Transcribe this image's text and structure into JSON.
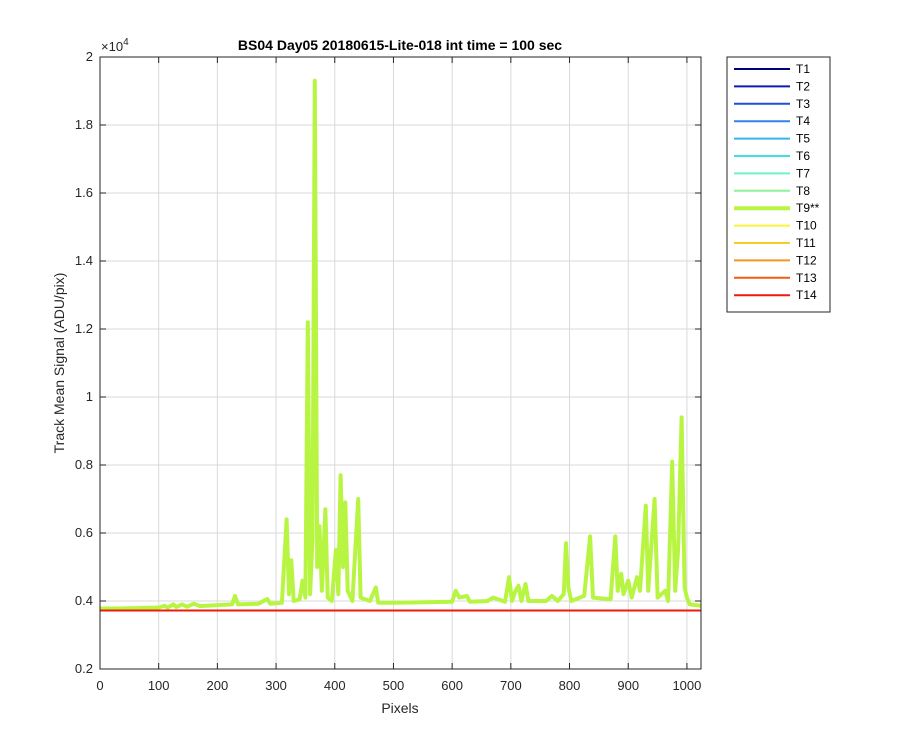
{
  "chart_data": {
    "type": "line",
    "title": "BS04 Day05 20180615-Lite-018 int time = 100 sec",
    "xlabel": "Pixels",
    "ylabel": "Track Mean Signal (ADU/pix)",
    "xlim": [
      0,
      1024
    ],
    "ylim": [
      2000,
      20000
    ],
    "y_exponent_label": "×10",
    "y_exponent_power": "4",
    "x_ticks": [
      0,
      100,
      200,
      300,
      400,
      500,
      600,
      700,
      800,
      900,
      1000
    ],
    "x_tick_labels": [
      "0",
      "100",
      "200",
      "300",
      "400",
      "500",
      "600",
      "700",
      "800",
      "900",
      "1000"
    ],
    "y_ticks": [
      2000,
      4000,
      6000,
      8000,
      10000,
      12000,
      14000,
      16000,
      18000,
      20000
    ],
    "y_tick_labels": [
      "0.2",
      "0.4",
      "0.6",
      "0.8",
      "1",
      "1.2",
      "1.4",
      "1.6",
      "1.8",
      "2"
    ],
    "grid": true,
    "legend_position": "outside-right",
    "series": [
      {
        "name": "T1",
        "color": "#00007a",
        "width": 2,
        "values": [
          [
            0,
            3720
          ],
          [
            1024,
            3720
          ]
        ]
      },
      {
        "name": "T2",
        "color": "#0a1fb5",
        "width": 2,
        "values": [
          [
            0,
            3720
          ],
          [
            1024,
            3720
          ]
        ]
      },
      {
        "name": "T3",
        "color": "#1e4fd8",
        "width": 2,
        "values": [
          [
            0,
            3720
          ],
          [
            1024,
            3720
          ]
        ]
      },
      {
        "name": "T4",
        "color": "#2f86e8",
        "width": 2,
        "values": [
          [
            0,
            3720
          ],
          [
            1024,
            3720
          ]
        ]
      },
      {
        "name": "T5",
        "color": "#35b4f0",
        "width": 2,
        "values": [
          [
            0,
            3720
          ],
          [
            1024,
            3720
          ]
        ]
      },
      {
        "name": "T6",
        "color": "#3ee0e8",
        "width": 2,
        "values": [
          [
            0,
            3720
          ],
          [
            1024,
            3720
          ]
        ]
      },
      {
        "name": "T7",
        "color": "#6ef0c8",
        "width": 2,
        "values": [
          [
            0,
            3720
          ],
          [
            1024,
            3720
          ]
        ]
      },
      {
        "name": "T8",
        "color": "#8ff09a",
        "width": 2,
        "values": [
          [
            0,
            3720
          ],
          [
            1024,
            3720
          ]
        ]
      },
      {
        "name": "T9**",
        "color": "#b8f542",
        "width": 4,
        "values": [
          [
            0,
            3780
          ],
          [
            30,
            3780
          ],
          [
            60,
            3790
          ],
          [
            100,
            3810
          ],
          [
            110,
            3860
          ],
          [
            115,
            3800
          ],
          [
            125,
            3900
          ],
          [
            130,
            3820
          ],
          [
            140,
            3900
          ],
          [
            148,
            3830
          ],
          [
            160,
            3920
          ],
          [
            170,
            3850
          ],
          [
            200,
            3880
          ],
          [
            225,
            3900
          ],
          [
            230,
            4150
          ],
          [
            235,
            3900
          ],
          [
            270,
            3920
          ],
          [
            285,
            4060
          ],
          [
            290,
            3920
          ],
          [
            310,
            3950
          ],
          [
            318,
            6400
          ],
          [
            322,
            4200
          ],
          [
            326,
            5200
          ],
          [
            330,
            4000
          ],
          [
            340,
            4050
          ],
          [
            345,
            4600
          ],
          [
            350,
            4100
          ],
          [
            354,
            12200
          ],
          [
            358,
            4200
          ],
          [
            362,
            5800
          ],
          [
            366,
            19300
          ],
          [
            370,
            5000
          ],
          [
            374,
            6200
          ],
          [
            378,
            4300
          ],
          [
            384,
            6700
          ],
          [
            388,
            4100
          ],
          [
            395,
            4000
          ],
          [
            402,
            5500
          ],
          [
            406,
            4200
          ],
          [
            410,
            7700
          ],
          [
            414,
            5000
          ],
          [
            418,
            6900
          ],
          [
            422,
            4300
          ],
          [
            430,
            4000
          ],
          [
            440,
            7000
          ],
          [
            444,
            4100
          ],
          [
            460,
            4000
          ],
          [
            470,
            4400
          ],
          [
            474,
            3950
          ],
          [
            500,
            3950
          ],
          [
            540,
            3960
          ],
          [
            600,
            3980
          ],
          [
            606,
            4300
          ],
          [
            612,
            4100
          ],
          [
            625,
            4150
          ],
          [
            630,
            3980
          ],
          [
            660,
            4000
          ],
          [
            670,
            4100
          ],
          [
            690,
            3980
          ],
          [
            697,
            4700
          ],
          [
            702,
            4000
          ],
          [
            708,
            4300
          ],
          [
            713,
            4450
          ],
          [
            718,
            4000
          ],
          [
            725,
            4500
          ],
          [
            730,
            4000
          ],
          [
            760,
            4000
          ],
          [
            770,
            4150
          ],
          [
            780,
            4000
          ],
          [
            790,
            4200
          ],
          [
            794,
            5700
          ],
          [
            798,
            4400
          ],
          [
            803,
            4000
          ],
          [
            825,
            4150
          ],
          [
            835,
            5900
          ],
          [
            840,
            4100
          ],
          [
            870,
            4050
          ],
          [
            878,
            5900
          ],
          [
            882,
            4300
          ],
          [
            888,
            4800
          ],
          [
            892,
            4200
          ],
          [
            900,
            4600
          ],
          [
            906,
            4100
          ],
          [
            915,
            4700
          ],
          [
            920,
            4300
          ],
          [
            930,
            6800
          ],
          [
            934,
            4300
          ],
          [
            945,
            7000
          ],
          [
            950,
            4100
          ],
          [
            963,
            4300
          ],
          [
            968,
            4000
          ],
          [
            975,
            8100
          ],
          [
            980,
            4300
          ],
          [
            985,
            5500
          ],
          [
            991,
            9400
          ],
          [
            996,
            4400
          ],
          [
            1000,
            4100
          ],
          [
            1005,
            3900
          ],
          [
            1024,
            3860
          ]
        ]
      },
      {
        "name": "T10",
        "color": "#f5f542",
        "width": 2,
        "values": [
          [
            0,
            3720
          ],
          [
            1024,
            3720
          ]
        ]
      },
      {
        "name": "T11",
        "color": "#f5cc2a",
        "width": 2,
        "values": [
          [
            0,
            3720
          ],
          [
            1024,
            3720
          ]
        ]
      },
      {
        "name": "T12",
        "color": "#f59420",
        "width": 2,
        "values": [
          [
            0,
            3720
          ],
          [
            1024,
            3720
          ]
        ]
      },
      {
        "name": "T13",
        "color": "#f35a12",
        "width": 2,
        "values": [
          [
            0,
            3720
          ],
          [
            1024,
            3720
          ]
        ]
      },
      {
        "name": "T14",
        "color": "#ef1a0a",
        "width": 2,
        "values": [
          [
            0,
            3720
          ],
          [
            1024,
            3720
          ]
        ]
      }
    ]
  }
}
